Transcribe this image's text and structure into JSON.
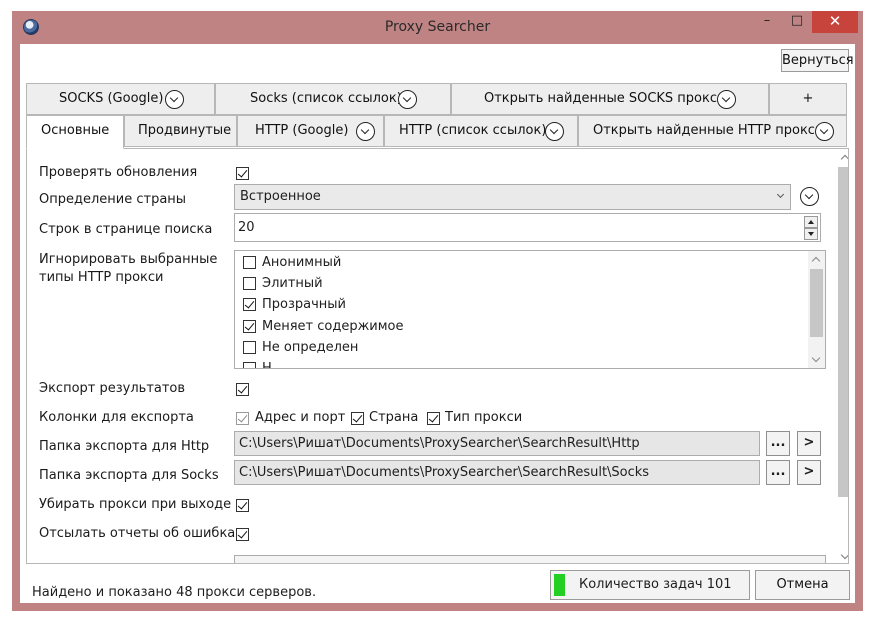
{
  "window": {
    "title": "Proxy Searcher",
    "min_glyph": "–",
    "max_glyph": "□",
    "close_glyph": "✕"
  },
  "toolbar": {
    "back_label": "Вернуться"
  },
  "tabs_row1": [
    {
      "label": "SOCKS (Google)",
      "has_dropdown": true
    },
    {
      "label": "Socks (список ссылок)",
      "has_dropdown": true
    },
    {
      "label": "Открыть найденные SOCKS прокси",
      "has_dropdown": true
    },
    {
      "label": "+",
      "has_dropdown": false
    }
  ],
  "tabs_row2": [
    {
      "label": "Основные",
      "active": true
    },
    {
      "label": "Продвинутые",
      "active": false
    },
    {
      "label": "HTTP (Google)",
      "has_dropdown": true
    },
    {
      "label": "HTTP (список ссылок)",
      "has_dropdown": true
    },
    {
      "label": "Открыть найденные HTTP прокси",
      "has_dropdown": true
    }
  ],
  "settings": {
    "check_updates": {
      "label": "Проверять обновления",
      "checked": true
    },
    "country_detection": {
      "label": "Определение страны",
      "value": "Встроенное"
    },
    "rows_per_page": {
      "label": "Строк в странице поиска",
      "value": "20"
    },
    "ignore_types": {
      "label": "Игнорировать выбранные типы HTTP прокси",
      "items": [
        {
          "label": "Анонимный",
          "checked": false
        },
        {
          "label": "Элитный",
          "checked": false
        },
        {
          "label": "Прозрачный",
          "checked": true
        },
        {
          "label": "Меняет содержимое",
          "checked": true
        },
        {
          "label": "Не определен",
          "checked": false
        },
        {
          "label": "Н...",
          "checked": false
        }
      ]
    },
    "export_results": {
      "label": "Экспорт результатов",
      "checked": true
    },
    "export_columns": {
      "label": "Колонки для експорта",
      "items": [
        {
          "label": "Адрес и порт",
          "checked": true,
          "disabled": true
        },
        {
          "label": "Страна",
          "checked": true,
          "disabled": false
        },
        {
          "label": "Тип прокси",
          "checked": true,
          "disabled": false
        }
      ]
    },
    "http_folder": {
      "label": "Папка экспорта для Http",
      "value": "C:\\Users\\Ришат\\Documents\\ProxySearcher\\SearchResult\\Http",
      "browse": "...",
      "open": ">"
    },
    "socks_folder": {
      "label": "Папка экспорта для Socks",
      "value": "C:\\Users\\Ришат\\Documents\\ProxySearcher\\SearchResult\\Socks",
      "browse": "...",
      "open": ">"
    },
    "remove_on_exit": {
      "label": "Убирать прокси при выходе",
      "checked": true
    },
    "send_reports": {
      "label": "Отсылать отчеты об ошибках",
      "checked": true
    }
  },
  "status": {
    "text": "Найдено и показано 48 прокси серверов.",
    "tasks_label": "Количество задач 101",
    "tasks_indicator_color": "#23cf23",
    "cancel_label": "Отмена"
  },
  "colors": {
    "window_frame": "#c08383",
    "close_button": "#c7443d"
  }
}
